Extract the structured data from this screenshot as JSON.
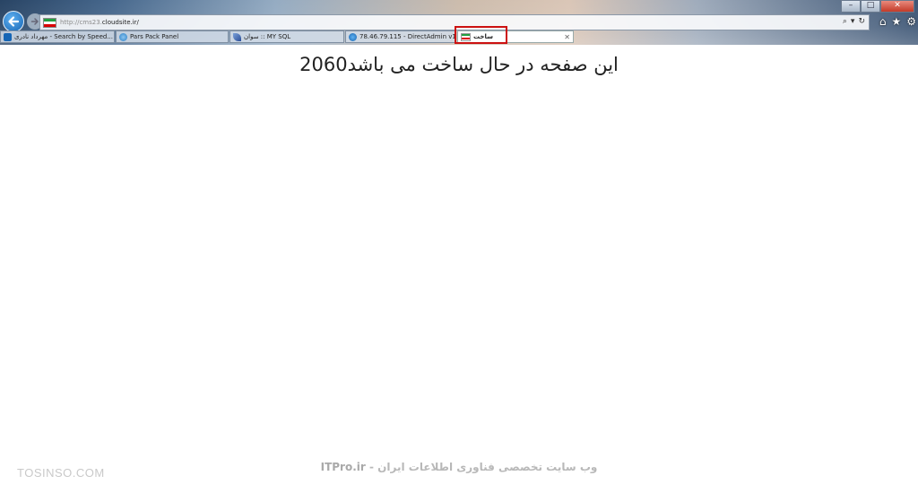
{
  "browser": {
    "url_prefix": "http://cms23.",
    "url_domain": "cloudsite.ir/",
    "window_controls": {
      "minimize": "–",
      "maximize": "□",
      "close": "✕"
    },
    "tabs": [
      {
        "label": "مهرداد نادری - Search by Speed...",
        "icon": "globe-icon"
      },
      {
        "label": "Pars Pack Panel",
        "icon": "ie-icon"
      },
      {
        "label": "سوان :: MY SQL",
        "icon": "feather-icon"
      },
      {
        "label": "78.46.79.115 - DirectAdmin v1...",
        "icon": "globe-icon"
      },
      {
        "label": "ساخت",
        "icon": "iran-flag-icon",
        "active": true
      }
    ],
    "tab_close_glyph": "✕",
    "accent_color": "#cc1111"
  },
  "page": {
    "heading": "این صفحه در حال ساخت می باشد2060"
  },
  "watermarks": {
    "footer_brand": "ITPro.ir",
    "footer_text": " - وب سایت تخصصی فناوری اطلاعات ایران",
    "corner": "TOSINSO.COM"
  }
}
